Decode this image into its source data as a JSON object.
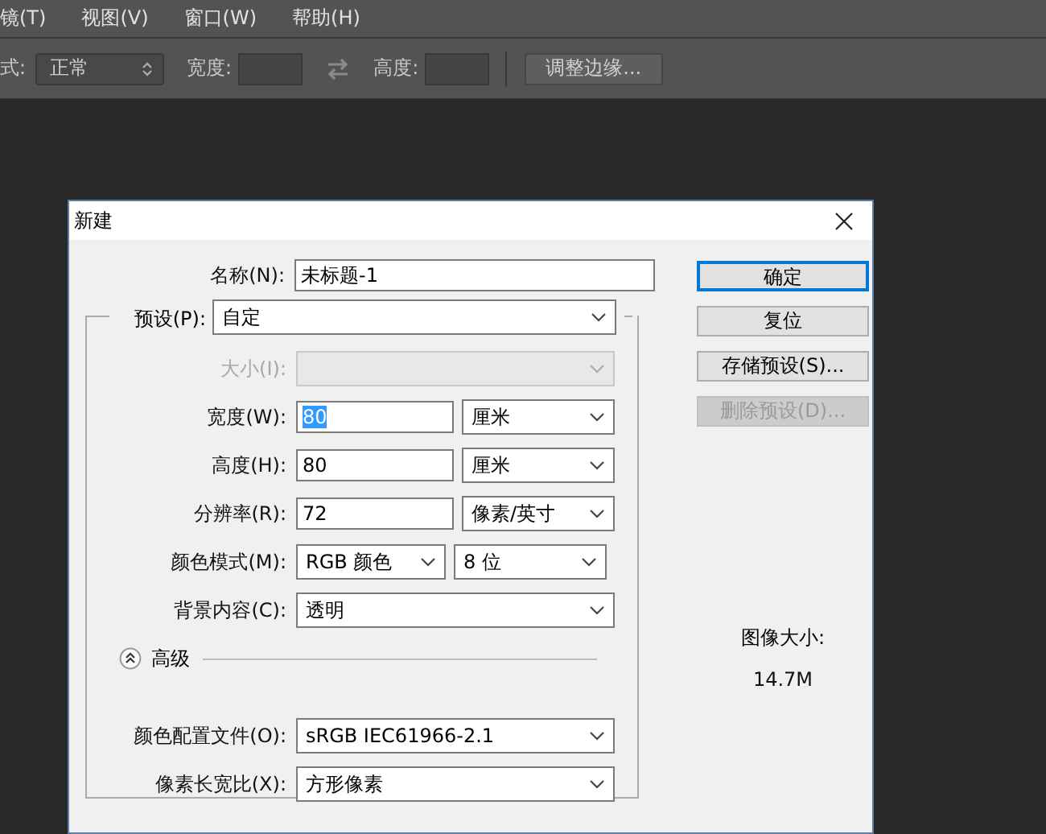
{
  "menu": [
    {
      "label": "镜(T)"
    },
    {
      "label": "视图(V)"
    },
    {
      "label": "窗口(W)"
    },
    {
      "label": "帮助(H)"
    }
  ],
  "options_bar": {
    "style_label": "式:",
    "style_value": "正常",
    "width_label": "宽度:",
    "height_label": "高度:",
    "refine_button": "调整边缘..."
  },
  "dialog": {
    "title": "新建",
    "name": {
      "label": "名称(N):",
      "value": "未标题-1"
    },
    "preset": {
      "label": "预设(P):",
      "value": "自定"
    },
    "rows": [
      {
        "kind": "select",
        "label": "大小(I):",
        "disabled": true
      },
      {
        "kind": "input_unit",
        "label": "宽度(W):",
        "value": "80",
        "value_selected": true,
        "unit": "厘米"
      },
      {
        "kind": "input_unit",
        "label": "高度(H):",
        "value": "80",
        "value_selected": false,
        "unit": "厘米"
      },
      {
        "kind": "input_unit",
        "label": "分辨率(R):",
        "value": "72",
        "value_selected": false,
        "unit": "像素/英寸"
      },
      {
        "kind": "select_pair",
        "label": "颜色模式(M):",
        "value": "RGB 颜色",
        "unit": "8 位"
      },
      {
        "kind": "select",
        "label": "背景内容(C):",
        "value": "透明",
        "disabled": false
      }
    ],
    "advanced": {
      "label": "高级",
      "expanded": true
    },
    "advanced_rows": [
      {
        "kind": "select",
        "label": "颜色配置文件(O):",
        "value": "sRGB IEC61966-2.1",
        "disabled": false
      },
      {
        "kind": "select",
        "label": "像素长宽比(X):",
        "value": "方形像素",
        "disabled": false
      }
    ],
    "buttons": [
      {
        "label": "确定",
        "default": true,
        "disabled": false
      },
      {
        "label": "复位",
        "default": false,
        "disabled": false
      },
      {
        "label": "存储预设(S)...",
        "default": false,
        "disabled": false
      },
      {
        "label": "删除预设(D)...",
        "default": false,
        "disabled": true
      }
    ],
    "image_size": {
      "label": "图像大小:",
      "value": "14.7M"
    }
  }
}
